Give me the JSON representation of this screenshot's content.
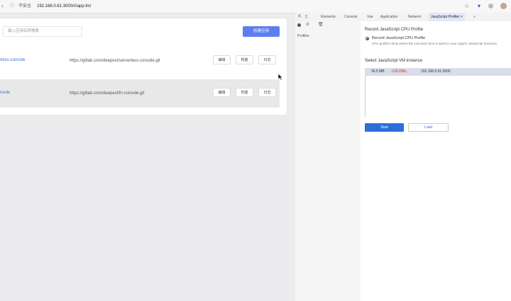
{
  "browser": {
    "security_label": "不安全",
    "url": "192.168.0.61:3000/#/app-list"
  },
  "app": {
    "search_placeholder": "输入应用名称搜索",
    "create_button": "创建应用",
    "rows": [
      {
        "name": "rless-console",
        "repo": "https://gitlab.com/deepexi/serverless-console.git",
        "actions": [
          "编辑",
          "构建",
          "日志"
        ]
      },
      {
        "name": "nsole",
        "repo": "https://gitlab.com/deepexi/fn-console.git",
        "actions": [
          "编辑",
          "构建",
          "日志"
        ]
      }
    ]
  },
  "devtools": {
    "tabs": [
      "Elements",
      "Console",
      "Vue",
      "Application",
      "Network",
      "JavaScript Profiler"
    ],
    "more": "»",
    "sidebar_label": "Profiles",
    "section_title": "Record JavaScript CPU Profile",
    "radio_label": "Record JavaScript CPU Profile",
    "radio_desc": "CPU profiles show where the execution time is spent in your page's JavaScript functions.",
    "vm_title": "Select JavaScript VM instance",
    "vm_row": {
      "size": "36.5 MB",
      "rate": "↑126 KB/s",
      "host": "192.168.0.61:3000"
    },
    "start_label": "Start",
    "load_label": "Load"
  },
  "colors": {
    "accent": "#5b7ff0",
    "devtools_blue": "#2a6fdb",
    "rate_red": "#e02020"
  }
}
